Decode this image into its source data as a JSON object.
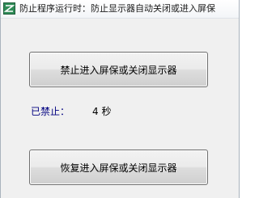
{
  "window": {
    "title": "防止程序运行时：防止显示器自动关闭或进入屏保",
    "icon": "app-icon"
  },
  "buttons": {
    "disable_label": "禁止进入屏保或关闭显示器",
    "restore_label": "恢复进入屏保或关闭显示器"
  },
  "status": {
    "label": "已禁止：",
    "value": "4 秒"
  }
}
